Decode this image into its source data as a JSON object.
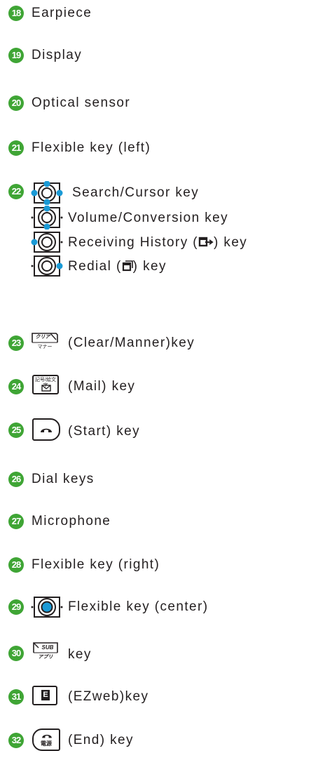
{
  "items": [
    {
      "num": "18",
      "label": "Earpiece"
    },
    {
      "num": "19",
      "label": "Display"
    },
    {
      "num": "20",
      "label": "Optical sensor"
    },
    {
      "num": "21",
      "label": "Flexible key (left)"
    },
    {
      "num": "22",
      "label": "Search/Cursor key",
      "sub": [
        "Volume/Conversion key",
        "Receiving History (",
        ") key",
        "Redial (",
        ") key"
      ]
    },
    {
      "num": "23",
      "label": "(Clear/Manner)key",
      "key_top": "クリア",
      "key_bottom": "マナー"
    },
    {
      "num": "24",
      "label": "(Mail) key",
      "key_top": "記号/絵文字"
    },
    {
      "num": "25",
      "label": "(Start) key"
    },
    {
      "num": "26",
      "label": "Dial keys"
    },
    {
      "num": "27",
      "label": "Microphone"
    },
    {
      "num": "28",
      "label": "Flexible key (right)"
    },
    {
      "num": "29",
      "label": "Flexible key (center)"
    },
    {
      "num": "30",
      "label": "key",
      "key_top": "SUB",
      "key_bottom": "アプリ"
    },
    {
      "num": "31",
      "label": "(EZweb)key",
      "key_top": "E"
    },
    {
      "num": "32",
      "label": "(End) key",
      "key_bottom": "電源"
    }
  ],
  "colors": {
    "badge": "#3fa535",
    "highlight": "#1a9ad6",
    "text": "#231f20"
  }
}
